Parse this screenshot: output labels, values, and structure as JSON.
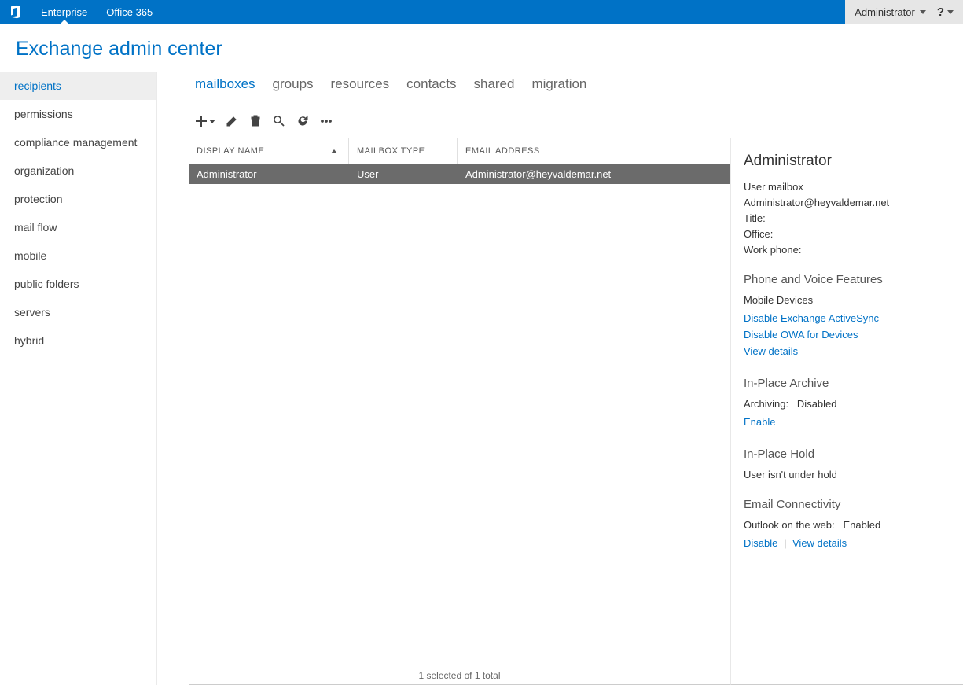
{
  "topbar": {
    "tabs": [
      {
        "label": "Enterprise",
        "active": true
      },
      {
        "label": "Office 365",
        "active": false
      }
    ],
    "user": "Administrator"
  },
  "page_title": "Exchange admin center",
  "sidebar": {
    "items": [
      {
        "label": "recipients",
        "active": true
      },
      {
        "label": "permissions"
      },
      {
        "label": "compliance management"
      },
      {
        "label": "organization"
      },
      {
        "label": "protection"
      },
      {
        "label": "mail flow"
      },
      {
        "label": "mobile"
      },
      {
        "label": "public folders"
      },
      {
        "label": "servers"
      },
      {
        "label": "hybrid"
      }
    ]
  },
  "subtabs": [
    {
      "label": "mailboxes",
      "active": true
    },
    {
      "label": "groups"
    },
    {
      "label": "resources"
    },
    {
      "label": "contacts"
    },
    {
      "label": "shared"
    },
    {
      "label": "migration"
    }
  ],
  "table": {
    "columns": [
      "DISPLAY NAME",
      "MAILBOX TYPE",
      "EMAIL ADDRESS"
    ],
    "rows": [
      {
        "display_name": "Administrator",
        "mailbox_type": "User",
        "email": "Administrator@heyvaldemar.net"
      }
    ]
  },
  "details": {
    "name": "Administrator",
    "mailbox_kind": "User mailbox",
    "email": "Administrator@heyvaldemar.net",
    "title_label": "Title:",
    "office_label": "Office:",
    "workphone_label": "Work phone:",
    "phone_voice_heading": "Phone and Voice Features",
    "mobile_devices_label": "Mobile Devices",
    "disable_eas": "Disable Exchange ActiveSync",
    "disable_owa_devices": "Disable OWA for Devices",
    "view_details": "View details",
    "archive_heading": "In-Place Archive",
    "archiving_label": "Archiving:",
    "archiving_status": "Disabled",
    "enable": "Enable",
    "hold_heading": "In-Place Hold",
    "hold_status": "User isn't under hold",
    "email_conn_heading": "Email Connectivity",
    "owa_label": "Outlook on the web:",
    "owa_status": "Enabled",
    "disable": "Disable"
  },
  "status_bar": "1 selected of 1 total"
}
